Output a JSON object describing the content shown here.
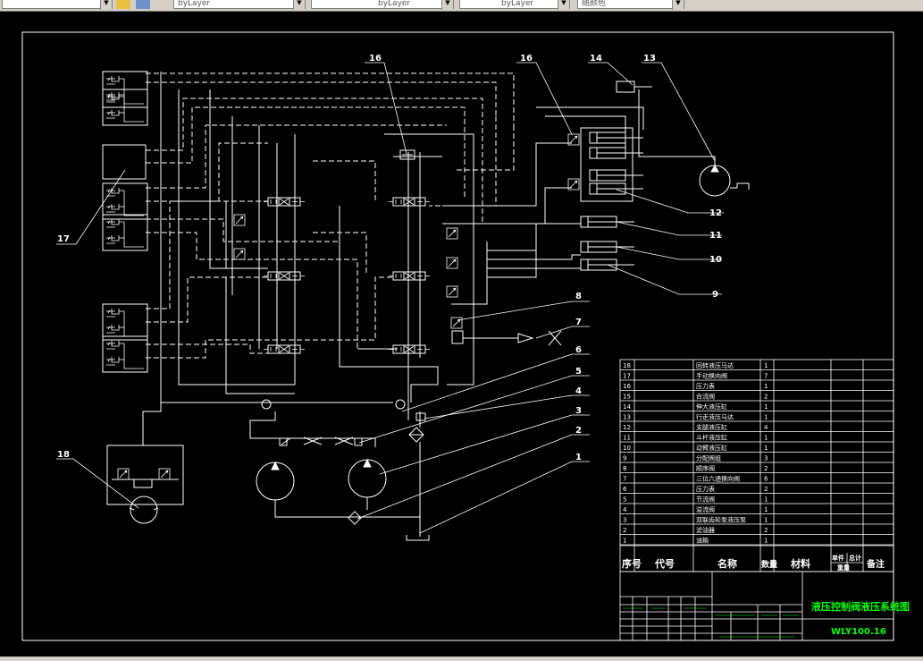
{
  "toolbar": {
    "layer_combo": "byLayer",
    "linetype_combo": "byLayer",
    "lineweight_combo": "byLayer",
    "color_combo": "随颜色"
  },
  "callouts": [
    "16",
    "16",
    "14",
    "13",
    "17",
    "12",
    "11",
    "10",
    "9",
    "8",
    "7",
    "6",
    "5",
    "4",
    "3",
    "2",
    "1",
    "18"
  ],
  "title_block": {
    "drawing_title": "液压控制阀液压系统图",
    "drawing_number": "WLY100.16",
    "header": {
      "seq": "序号",
      "code": "代号",
      "name": "名称",
      "qty": "数量",
      "material": "材料",
      "unit_weight": "单件",
      "total_weight": "总计",
      "weight": "重量",
      "remarks": "备注"
    },
    "rows": [
      {
        "seq": "18",
        "name": "回转液压马达",
        "qty": "1"
      },
      {
        "seq": "17",
        "name": "手动换向阀",
        "qty": "7"
      },
      {
        "seq": "16",
        "name": "压力表",
        "qty": "1"
      },
      {
        "seq": "15",
        "name": "合流阀",
        "qty": "2"
      },
      {
        "seq": "14",
        "name": "伸大液压缸",
        "qty": "1"
      },
      {
        "seq": "13",
        "name": "行走液压马达",
        "qty": "1"
      },
      {
        "seq": "12",
        "name": "支腿液压缸",
        "qty": "4"
      },
      {
        "seq": "11",
        "name": "斗杆液压缸",
        "qty": "1"
      },
      {
        "seq": "10",
        "name": "动臂液压缸",
        "qty": "1"
      },
      {
        "seq": "9",
        "name": "分配阀组",
        "qty": "3"
      },
      {
        "seq": "8",
        "name": "顺序阀",
        "qty": "2"
      },
      {
        "seq": "7",
        "name": "三位六通换向阀",
        "qty": "6"
      },
      {
        "seq": "6",
        "name": "压力表",
        "qty": "2"
      },
      {
        "seq": "5",
        "name": "节流阀",
        "qty": "1"
      },
      {
        "seq": "4",
        "name": "溢流阀",
        "qty": "1"
      },
      {
        "seq": "3",
        "name": "双联齿轮泵液压泵",
        "qty": "1"
      },
      {
        "seq": "2",
        "name": "滤油器",
        "qty": "2"
      },
      {
        "seq": "1",
        "name": "油箱",
        "qty": "1"
      }
    ]
  }
}
